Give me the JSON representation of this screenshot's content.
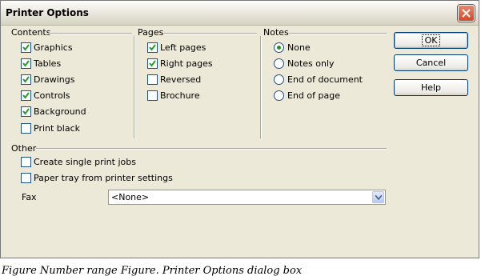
{
  "dialog": {
    "title": "Printer Options"
  },
  "contents": {
    "label": "Contents",
    "items": [
      {
        "label": "Graphics",
        "checked": true
      },
      {
        "label": "Tables",
        "checked": true
      },
      {
        "label": "Drawings",
        "checked": true
      },
      {
        "label": "Controls",
        "checked": true
      },
      {
        "label": "Background",
        "checked": true
      },
      {
        "label": "Print black",
        "checked": false
      }
    ]
  },
  "pages": {
    "label": "Pages",
    "items": [
      {
        "label": "Left pages",
        "checked": true
      },
      {
        "label": "Right pages",
        "checked": true
      },
      {
        "label": "Reversed",
        "checked": false
      },
      {
        "label": "Brochure",
        "checked": false
      }
    ]
  },
  "notes": {
    "label": "Notes",
    "options": [
      {
        "label": "None",
        "selected": true
      },
      {
        "label": "Notes only",
        "selected": false
      },
      {
        "label": "End of document",
        "selected": false
      },
      {
        "label": "End of page",
        "selected": false
      }
    ]
  },
  "other": {
    "label": "Other",
    "items": [
      {
        "label": "Create single print jobs",
        "checked": false
      },
      {
        "label": "Paper tray from printer settings",
        "checked": false
      }
    ],
    "fax_label": "Fax",
    "fax_value": "<None>"
  },
  "buttons": {
    "ok": "OK",
    "cancel": "Cancel",
    "help": "Help"
  },
  "caption": "Figure Number range Figure. Printer Options dialog box",
  "colors": {
    "dialog_bg": "#ECE9D8",
    "check": "#21a121",
    "close": "#d3482a"
  }
}
